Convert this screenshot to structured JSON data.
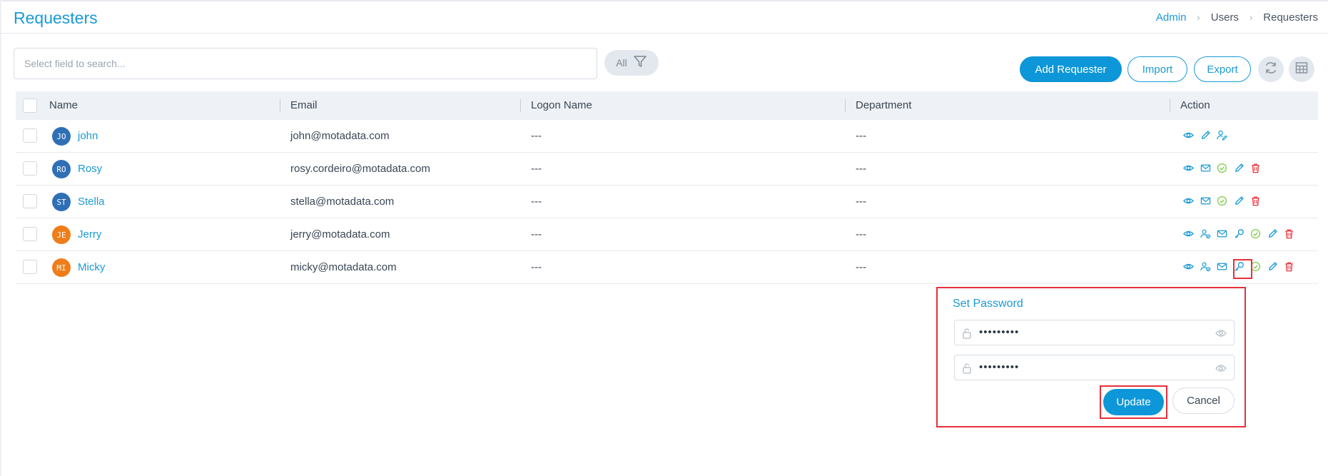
{
  "header": {
    "title": "Requesters",
    "breadcrumb": [
      "Admin",
      "Users",
      "Requesters"
    ]
  },
  "toolbar": {
    "search_placeholder": "Select field to search...",
    "filter_label": "All",
    "add_label": "Add Requester",
    "import_label": "Import",
    "export_label": "Export"
  },
  "table": {
    "columns": [
      "Name",
      "Email",
      "Logon Name",
      "Department",
      "Action"
    ],
    "rows": [
      {
        "initials": "JO",
        "avatar_color": "#2f6fb5",
        "name": "john",
        "email": "john@motadata.com",
        "logon": "---",
        "department": "---",
        "actions": [
          "eye-icon",
          "edit-icon",
          "user-edit-icon"
        ]
      },
      {
        "initials": "RO",
        "avatar_color": "#2f6fb5",
        "name": "Rosy",
        "email": "rosy.cordeiro@motadata.com",
        "logon": "---",
        "department": "---",
        "actions": [
          "eye-icon",
          "mail-icon",
          "check-circle-icon",
          "edit-icon",
          "trash-icon"
        ]
      },
      {
        "initials": "ST",
        "avatar_color": "#2f6fb5",
        "name": "Stella",
        "email": "stella@motadata.com",
        "logon": "---",
        "department": "---",
        "actions": [
          "eye-icon",
          "mail-icon",
          "check-circle-icon",
          "edit-icon",
          "trash-icon"
        ]
      },
      {
        "initials": "JE",
        "avatar_color": "#ef7d1a",
        "name": "Jerry",
        "email": "jerry@motadata.com",
        "logon": "---",
        "department": "---",
        "actions": [
          "eye-icon",
          "users-icon",
          "mail-icon",
          "key-icon",
          "check-circle-icon",
          "edit-icon",
          "trash-icon"
        ]
      },
      {
        "initials": "MI",
        "avatar_color": "#ef7d1a",
        "name": "Micky",
        "email": "micky@motadata.com",
        "logon": "---",
        "department": "---",
        "actions": [
          "eye-icon",
          "users-icon",
          "mail-icon",
          "key-icon",
          "check-circle-icon",
          "edit-icon",
          "trash-icon"
        ]
      }
    ]
  },
  "set_password": {
    "title": "Set Password",
    "password_value": "•••••••••",
    "confirm_value": "•••••••••",
    "update_label": "Update",
    "cancel_label": "Cancel"
  },
  "colors": {
    "accent": "#1a9ad6",
    "primary_button": "#0d97d8",
    "success": "#7ac943",
    "danger": "#e5303a",
    "highlight": "#e5303a"
  }
}
